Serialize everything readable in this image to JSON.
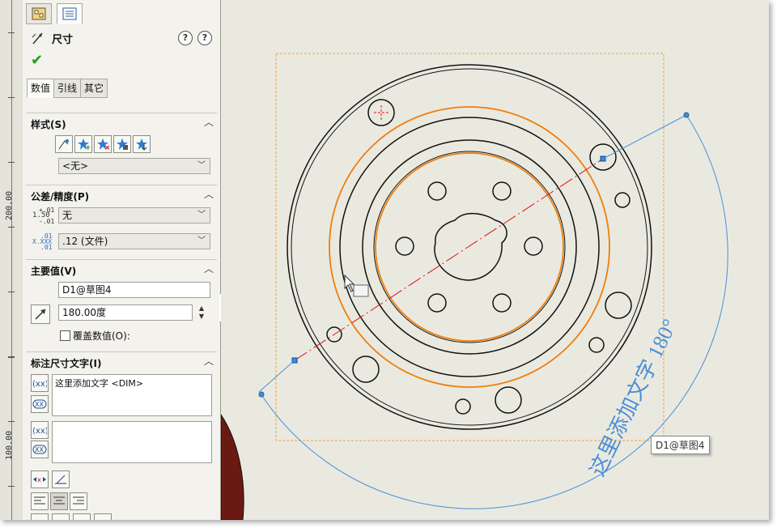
{
  "panel": {
    "title": "尺寸",
    "help_icon": "?",
    "tabs": [
      "数值",
      "引线",
      "其它"
    ],
    "style_group": {
      "title": "样式(S)",
      "dropdown_value": "<无>"
    },
    "tolerance_group": {
      "title": "公差/精度(P)",
      "tolerance_value": "无",
      "precision_value": ".12 (文件)",
      "tol_icon_text": [
        "+.01",
        "1.50",
        "-.01"
      ],
      "prec_icon_text": [
        ".01",
        "X.XXX",
        ".01"
      ]
    },
    "primary_group": {
      "title": "主要值(V)",
      "name_value": "D1@草图4",
      "angle_value": "180.00度",
      "override_label": "覆盖数值(O):"
    },
    "dimtext_group": {
      "title": "标注尺寸文字(I)",
      "text_value": "这里添加文字 <DIM>"
    }
  },
  "ruler": {
    "labels": [
      "200.00",
      "100.00"
    ]
  },
  "canvas": {
    "dimension_text": "这里添加文字 180°",
    "tooltip": "D1@草图4"
  },
  "colors": {
    "sketch_black": "#111111",
    "construction_orange": "#ee7e0e",
    "centerline_red": "#dd1111",
    "dimension_blue": "#4a8fd6",
    "bbox_orange": "#f0a040"
  }
}
